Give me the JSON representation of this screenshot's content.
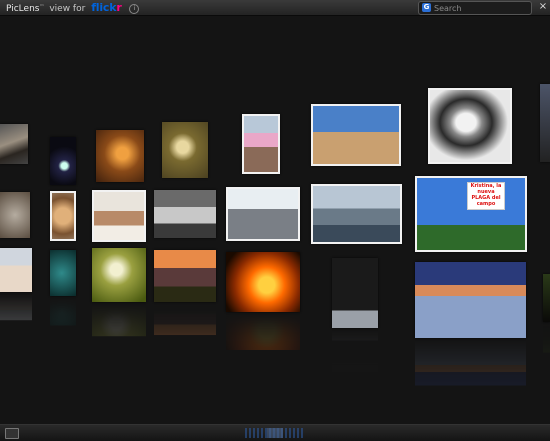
{
  "app": {
    "name": "PicLens",
    "trademark": "™",
    "view_for": "view for",
    "service": "flickr",
    "info_icon": "i"
  },
  "search": {
    "placeholder": "Search",
    "provider_icon": "G",
    "provider_name": "google-icon"
  },
  "window": {
    "close_label": "×"
  },
  "tiles": [
    {
      "name": "photo-beach-sunset-left",
      "interactable": true
    },
    {
      "name": "photo-dark-car-light",
      "interactable": true
    },
    {
      "name": "photo-candlelit-room",
      "interactable": true
    },
    {
      "name": "photo-flower-on-moss",
      "interactable": true
    },
    {
      "name": "photo-girls-fashion",
      "interactable": true
    },
    {
      "name": "photo-bride-desert",
      "interactable": true
    },
    {
      "name": "photo-girl-hoodie-bw",
      "interactable": true
    },
    {
      "name": "photo-edge-right-1",
      "interactable": true
    },
    {
      "name": "photo-left-bokeh",
      "interactable": true
    },
    {
      "name": "photo-cat-close",
      "interactable": true
    },
    {
      "name": "photo-couple-bed",
      "interactable": true
    },
    {
      "name": "photo-silver-car",
      "interactable": true
    },
    {
      "name": "photo-street-skateboard",
      "interactable": true
    },
    {
      "name": "photo-city-clouds",
      "interactable": true
    },
    {
      "name": "photo-protest-sign-field",
      "interactable": true
    },
    {
      "name": "photo-beach-people",
      "interactable": true
    },
    {
      "name": "photo-green-car",
      "interactable": true
    },
    {
      "name": "photo-dandelion-macro",
      "interactable": true
    },
    {
      "name": "photo-sunset-tree",
      "interactable": true
    },
    {
      "name": "photo-house-fire",
      "interactable": true
    },
    {
      "name": "photo-band-members",
      "interactable": true
    },
    {
      "name": "photo-frozen-lake-sunset",
      "interactable": true
    },
    {
      "name": "photo-edge-right-2",
      "interactable": true
    }
  ],
  "sign_text": "Kristina, la nueva PLAGA del campo",
  "colors": {
    "flickr_blue": "#0063dc",
    "flickr_pink": "#ff0084",
    "scroller": "#2d5aa0"
  }
}
